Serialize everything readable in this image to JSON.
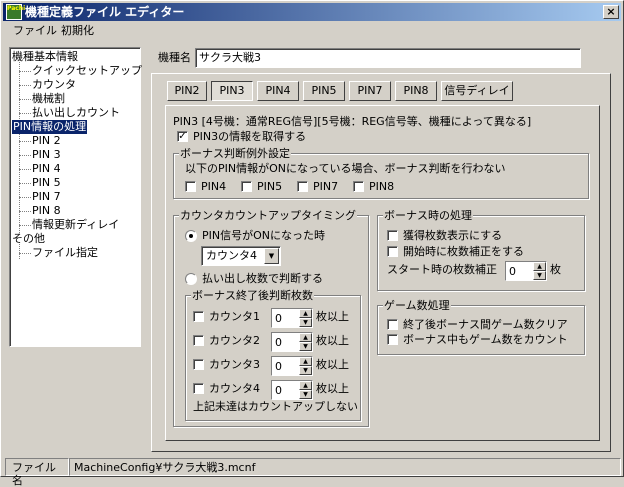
{
  "window": {
    "title": "機種定義ファイル エディター",
    "close_glyph": "×",
    "icon_text": "Pachi"
  },
  "menu": [
    "ファイル",
    "初期化"
  ],
  "sidebar": {
    "items": [
      {
        "label": "機種基本情報",
        "level": 0
      },
      {
        "label": "クイックセットアップ",
        "level": 1
      },
      {
        "label": "カウンタ",
        "level": 1
      },
      {
        "label": "機械割",
        "level": 1
      },
      {
        "label": "払い出しカウント",
        "level": 1
      },
      {
        "label": "PIN情報の処理",
        "level": 0,
        "selected": true
      },
      {
        "label": "PIN 2",
        "level": 1
      },
      {
        "label": "PIN 3",
        "level": 1
      },
      {
        "label": "PIN 4",
        "level": 1
      },
      {
        "label": "PIN 5",
        "level": 1
      },
      {
        "label": "PIN 7",
        "level": 1
      },
      {
        "label": "PIN 8",
        "level": 1
      },
      {
        "label": "情報更新ディレイ",
        "level": 1
      },
      {
        "label": "その他",
        "level": 0
      },
      {
        "label": "ファイル指定",
        "level": 1
      }
    ]
  },
  "model": {
    "label": "機種名",
    "value": "サクラ大戦3"
  },
  "tabs": [
    {
      "label": "PIN2"
    },
    {
      "label": "PIN3",
      "active": true
    },
    {
      "label": "PIN4"
    },
    {
      "label": "PIN5"
    },
    {
      "label": "PIN7"
    },
    {
      "label": "PIN8"
    },
    {
      "label": "信号ディレイ"
    }
  ],
  "pin3": {
    "description": "PIN3 [4号機：通常REG信号][5号機：REG信号等、機種によって異なる]",
    "acquire_label": "PIN3の情報を取得する",
    "acquire_checked": true,
    "bonus_exception": {
      "title": "ボーナス判断例外設定",
      "description": "以下のPIN情報がONになっている場合、ボーナス判断を行わない",
      "pins": [
        "PIN4",
        "PIN5",
        "PIN7",
        "PIN8"
      ]
    },
    "count_timing": {
      "title": "カウンタカウントアップタイミング",
      "radio_signal_label": "PIN信号がONになった時",
      "radio_signal_selected": true,
      "counter_select": "カウンタ4",
      "radio_payout_label": "払い出し枚数で判断する",
      "end_group": {
        "title": "ボーナス終了後判断枚数",
        "unit": "枚以上",
        "rows": [
          {
            "label": "カウンタ1",
            "value": "0"
          },
          {
            "label": "カウンタ2",
            "value": "0"
          },
          {
            "label": "カウンタ3",
            "value": "0"
          },
          {
            "label": "カウンタ4",
            "value": "0"
          }
        ],
        "note": "上記未達はカウントアップしない"
      }
    },
    "bonus_process": {
      "title": "ボーナス時の処理",
      "show_gain_label": "獲得枚数表示にする",
      "start_correct_label": "開始時に枚数補正をする",
      "start_count_label": "スタート時の枚数補正",
      "start_count_value": "0",
      "start_count_unit": "枚"
    },
    "game_count": {
      "title": "ゲーム数処理",
      "clear_label": "終了後ボーナス間ゲーム数クリア",
      "count_label": "ボーナス中もゲーム数をカウント"
    }
  },
  "status": {
    "label": "ファイル名",
    "value": "MachineConfig¥サクラ大戦3.mcnf"
  }
}
